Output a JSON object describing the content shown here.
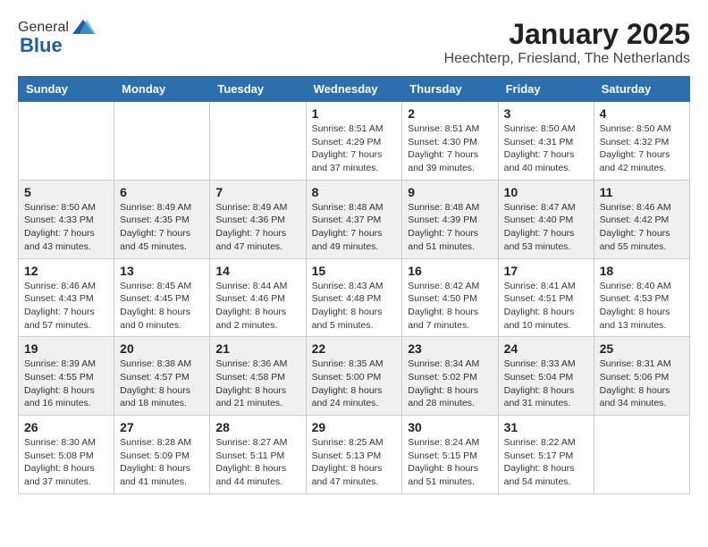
{
  "header": {
    "logo_general": "General",
    "logo_blue": "Blue",
    "title": "January 2025",
    "subtitle": "Heechterp, Friesland, The Netherlands"
  },
  "columns": [
    "Sunday",
    "Monday",
    "Tuesday",
    "Wednesday",
    "Thursday",
    "Friday",
    "Saturday"
  ],
  "weeks": [
    [
      {
        "day": "",
        "info": ""
      },
      {
        "day": "",
        "info": ""
      },
      {
        "day": "",
        "info": ""
      },
      {
        "day": "1",
        "info": "Sunrise: 8:51 AM\nSunset: 4:29 PM\nDaylight: 7 hours\nand 37 minutes."
      },
      {
        "day": "2",
        "info": "Sunrise: 8:51 AM\nSunset: 4:30 PM\nDaylight: 7 hours\nand 39 minutes."
      },
      {
        "day": "3",
        "info": "Sunrise: 8:50 AM\nSunset: 4:31 PM\nDaylight: 7 hours\nand 40 minutes."
      },
      {
        "day": "4",
        "info": "Sunrise: 8:50 AM\nSunset: 4:32 PM\nDaylight: 7 hours\nand 42 minutes."
      }
    ],
    [
      {
        "day": "5",
        "info": "Sunrise: 8:50 AM\nSunset: 4:33 PM\nDaylight: 7 hours\nand 43 minutes."
      },
      {
        "day": "6",
        "info": "Sunrise: 8:49 AM\nSunset: 4:35 PM\nDaylight: 7 hours\nand 45 minutes."
      },
      {
        "day": "7",
        "info": "Sunrise: 8:49 AM\nSunset: 4:36 PM\nDaylight: 7 hours\nand 47 minutes."
      },
      {
        "day": "8",
        "info": "Sunrise: 8:48 AM\nSunset: 4:37 PM\nDaylight: 7 hours\nand 49 minutes."
      },
      {
        "day": "9",
        "info": "Sunrise: 8:48 AM\nSunset: 4:39 PM\nDaylight: 7 hours\nand 51 minutes."
      },
      {
        "day": "10",
        "info": "Sunrise: 8:47 AM\nSunset: 4:40 PM\nDaylight: 7 hours\nand 53 minutes."
      },
      {
        "day": "11",
        "info": "Sunrise: 8:46 AM\nSunset: 4:42 PM\nDaylight: 7 hours\nand 55 minutes."
      }
    ],
    [
      {
        "day": "12",
        "info": "Sunrise: 8:46 AM\nSunset: 4:43 PM\nDaylight: 7 hours\nand 57 minutes."
      },
      {
        "day": "13",
        "info": "Sunrise: 8:45 AM\nSunset: 4:45 PM\nDaylight: 8 hours\nand 0 minutes."
      },
      {
        "day": "14",
        "info": "Sunrise: 8:44 AM\nSunset: 4:46 PM\nDaylight: 8 hours\nand 2 minutes."
      },
      {
        "day": "15",
        "info": "Sunrise: 8:43 AM\nSunset: 4:48 PM\nDaylight: 8 hours\nand 5 minutes."
      },
      {
        "day": "16",
        "info": "Sunrise: 8:42 AM\nSunset: 4:50 PM\nDaylight: 8 hours\nand 7 minutes."
      },
      {
        "day": "17",
        "info": "Sunrise: 8:41 AM\nSunset: 4:51 PM\nDaylight: 8 hours\nand 10 minutes."
      },
      {
        "day": "18",
        "info": "Sunrise: 8:40 AM\nSunset: 4:53 PM\nDaylight: 8 hours\nand 13 minutes."
      }
    ],
    [
      {
        "day": "19",
        "info": "Sunrise: 8:39 AM\nSunset: 4:55 PM\nDaylight: 8 hours\nand 16 minutes."
      },
      {
        "day": "20",
        "info": "Sunrise: 8:38 AM\nSunset: 4:57 PM\nDaylight: 8 hours\nand 18 minutes."
      },
      {
        "day": "21",
        "info": "Sunrise: 8:36 AM\nSunset: 4:58 PM\nDaylight: 8 hours\nand 21 minutes."
      },
      {
        "day": "22",
        "info": "Sunrise: 8:35 AM\nSunset: 5:00 PM\nDaylight: 8 hours\nand 24 minutes."
      },
      {
        "day": "23",
        "info": "Sunrise: 8:34 AM\nSunset: 5:02 PM\nDaylight: 8 hours\nand 28 minutes."
      },
      {
        "day": "24",
        "info": "Sunrise: 8:33 AM\nSunset: 5:04 PM\nDaylight: 8 hours\nand 31 minutes."
      },
      {
        "day": "25",
        "info": "Sunrise: 8:31 AM\nSunset: 5:06 PM\nDaylight: 8 hours\nand 34 minutes."
      }
    ],
    [
      {
        "day": "26",
        "info": "Sunrise: 8:30 AM\nSunset: 5:08 PM\nDaylight: 8 hours\nand 37 minutes."
      },
      {
        "day": "27",
        "info": "Sunrise: 8:28 AM\nSunset: 5:09 PM\nDaylight: 8 hours\nand 41 minutes."
      },
      {
        "day": "28",
        "info": "Sunrise: 8:27 AM\nSunset: 5:11 PM\nDaylight: 8 hours\nand 44 minutes."
      },
      {
        "day": "29",
        "info": "Sunrise: 8:25 AM\nSunset: 5:13 PM\nDaylight: 8 hours\nand 47 minutes."
      },
      {
        "day": "30",
        "info": "Sunrise: 8:24 AM\nSunset: 5:15 PM\nDaylight: 8 hours\nand 51 minutes."
      },
      {
        "day": "31",
        "info": "Sunrise: 8:22 AM\nSunset: 5:17 PM\nDaylight: 8 hours\nand 54 minutes."
      },
      {
        "day": "",
        "info": ""
      }
    ]
  ]
}
